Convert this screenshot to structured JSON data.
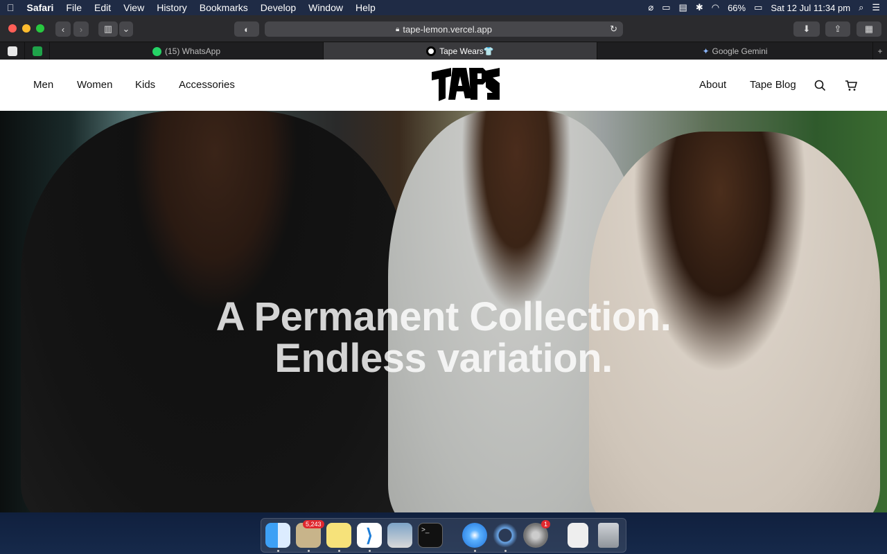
{
  "menubar": {
    "app": "Safari",
    "items": [
      "File",
      "Edit",
      "View",
      "History",
      "Bookmarks",
      "Develop",
      "Window",
      "Help"
    ],
    "battery": "66%",
    "datetime": "Sat 12 Jul  11:34 pm"
  },
  "browser": {
    "url": "tape-lemon.vercel.app",
    "tabs": [
      "(15) WhatsApp",
      "Tape Wears👕",
      "Google Gemini"
    ]
  },
  "site": {
    "logo": "TAPE",
    "nav_left": [
      "Men",
      "Women",
      "Kids",
      "Accessories"
    ],
    "nav_right": [
      "About",
      "Tape Blog"
    ],
    "hero": {
      "line1": "A Permanent Collection.",
      "line2": "Endless variation."
    }
  },
  "dock": {
    "mail_badge": "5,243",
    "settings_badge": "1"
  },
  "colors": {
    "badge": "#e0282e",
    "menubar": "#1f2b45"
  }
}
